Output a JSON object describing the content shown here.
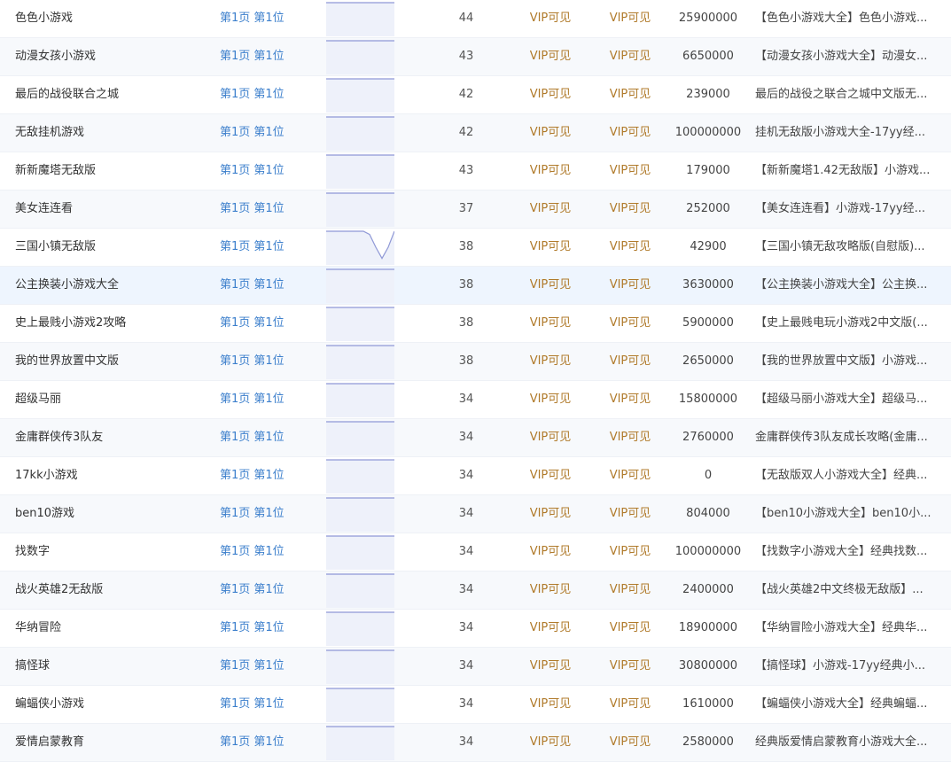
{
  "rows": [
    {
      "keyword": "色色小游戏",
      "rank": "第1页 第1位",
      "trend": [
        1,
        1,
        1,
        1,
        1,
        1,
        1
      ],
      "index": "44",
      "vip1": "VIP可见",
      "vip2": "VIP可见",
      "results": "25900000",
      "title": "【色色小游戏大全】色色小游戏..."
    },
    {
      "keyword": "动漫女孩小游戏",
      "rank": "第1页 第1位",
      "trend": [
        1,
        1,
        1,
        1,
        1,
        1,
        1
      ],
      "index": "43",
      "vip1": "VIP可见",
      "vip2": "VIP可见",
      "results": "6650000",
      "title": "【动漫女孩小游戏大全】动漫女..."
    },
    {
      "keyword": "最后的战役联合之城",
      "rank": "第1页 第1位",
      "trend": [
        1,
        1,
        1,
        1,
        1,
        1,
        1
      ],
      "index": "42",
      "vip1": "VIP可见",
      "vip2": "VIP可见",
      "results": "239000",
      "title": "最后的战役之联合之城中文版无..."
    },
    {
      "keyword": "无敌挂机游戏",
      "rank": "第1页 第1位",
      "trend": [
        1,
        1,
        1,
        1,
        1,
        1,
        1
      ],
      "index": "42",
      "vip1": "VIP可见",
      "vip2": "VIP可见",
      "results": "100000000",
      "title": "挂机无敌版小游戏大全-17yy经..."
    },
    {
      "keyword": "新新魔塔无敌版",
      "rank": "第1页 第1位",
      "trend": [
        1,
        1,
        1,
        1,
        1,
        1,
        1
      ],
      "index": "43",
      "vip1": "VIP可见",
      "vip2": "VIP可见",
      "results": "179000",
      "title": "【新新魔塔1.42无敌版】小游戏..."
    },
    {
      "keyword": "美女连连看",
      "rank": "第1页 第1位",
      "trend": [
        1,
        1,
        1,
        1,
        1,
        1,
        1
      ],
      "index": "37",
      "vip1": "VIP可见",
      "vip2": "VIP可见",
      "results": "252000",
      "title": "【美女连连看】小游戏-17yy经..."
    },
    {
      "keyword": "三国小镇无敌版",
      "rank": "第1页 第1位",
      "trend": [
        1,
        1,
        1,
        1,
        1,
        1,
        1,
        0.9,
        0.5,
        0.15,
        0.5,
        1
      ],
      "index": "38",
      "vip1": "VIP可见",
      "vip2": "VIP可见",
      "results": "42900",
      "title": "【三国小镇无敌攻略版(自慰版)..."
    },
    {
      "keyword": "公主换装小游戏大全",
      "rank": "第1页 第1位",
      "trend": [
        1,
        1,
        1,
        1,
        1,
        1,
        1
      ],
      "index": "38",
      "vip1": "VIP可见",
      "vip2": "VIP可见",
      "results": "3630000",
      "title": "【公主换装小游戏大全】公主换..."
    },
    {
      "keyword": "史上最贱小游戏2攻略",
      "rank": "第1页 第1位",
      "trend": [
        1,
        1,
        1,
        1,
        1,
        1,
        1
      ],
      "index": "38",
      "vip1": "VIP可见",
      "vip2": "VIP可见",
      "results": "5900000",
      "title": "【史上最贱电玩小游戏2中文版(..."
    },
    {
      "keyword": "我的世界放置中文版",
      "rank": "第1页 第1位",
      "trend": [
        1,
        1,
        1,
        1,
        1,
        1,
        1
      ],
      "index": "38",
      "vip1": "VIP可见",
      "vip2": "VIP可见",
      "results": "2650000",
      "title": "【我的世界放置中文版】小游戏..."
    },
    {
      "keyword": "超级马丽",
      "rank": "第1页 第1位",
      "trend": [
        1,
        1,
        1,
        1,
        1,
        1,
        1
      ],
      "index": "34",
      "vip1": "VIP可见",
      "vip2": "VIP可见",
      "results": "15800000",
      "title": "【超级马丽小游戏大全】超级马..."
    },
    {
      "keyword": "金庸群侠传3队友",
      "rank": "第1页 第1位",
      "trend": [
        1,
        1,
        1,
        1,
        1,
        1,
        1
      ],
      "index": "34",
      "vip1": "VIP可见",
      "vip2": "VIP可见",
      "results": "2760000",
      "title": "金庸群侠传3队友成长攻略(金庸..."
    },
    {
      "keyword": "17kk小游戏",
      "rank": "第1页 第1位",
      "trend": [
        1,
        1,
        1,
        1,
        1,
        1,
        1
      ],
      "index": "34",
      "vip1": "VIP可见",
      "vip2": "VIP可见",
      "results": "0",
      "title": "【无敌版双人小游戏大全】经典..."
    },
    {
      "keyword": "ben10游戏",
      "rank": "第1页 第1位",
      "trend": [
        1,
        1,
        1,
        1,
        1,
        1,
        1
      ],
      "index": "34",
      "vip1": "VIP可见",
      "vip2": "VIP可见",
      "results": "804000",
      "title": "【ben10小游戏大全】ben10小..."
    },
    {
      "keyword": "找数字",
      "rank": "第1页 第1位",
      "trend": [
        1,
        1,
        1,
        1,
        1,
        1,
        1
      ],
      "index": "34",
      "vip1": "VIP可见",
      "vip2": "VIP可见",
      "results": "100000000",
      "title": "【找数字小游戏大全】经典找数..."
    },
    {
      "keyword": "战火英雄2无敌版",
      "rank": "第1页 第1位",
      "trend": [
        1,
        1,
        1,
        1,
        1,
        1,
        1
      ],
      "index": "34",
      "vip1": "VIP可见",
      "vip2": "VIP可见",
      "results": "2400000",
      "title": "【战火英雄2中文终极无敌版】..."
    },
    {
      "keyword": "华纳冒险",
      "rank": "第1页 第1位",
      "trend": [
        1,
        1,
        1,
        1,
        1,
        1,
        1
      ],
      "index": "34",
      "vip1": "VIP可见",
      "vip2": "VIP可见",
      "results": "18900000",
      "title": "【华纳冒险小游戏大全】经典华..."
    },
    {
      "keyword": "搞怪球",
      "rank": "第1页 第1位",
      "trend": [
        1,
        1,
        1,
        1,
        1,
        1,
        1
      ],
      "index": "34",
      "vip1": "VIP可见",
      "vip2": "VIP可见",
      "results": "30800000",
      "title": "【搞怪球】小游戏-17yy经典小..."
    },
    {
      "keyword": "蝙蝠侠小游戏",
      "rank": "第1页 第1位",
      "trend": [
        1,
        1,
        1,
        1,
        1,
        1,
        1
      ],
      "index": "34",
      "vip1": "VIP可见",
      "vip2": "VIP可见",
      "results": "1610000",
      "title": "【蝙蝠侠小游戏大全】经典蝙蝠..."
    },
    {
      "keyword": "爱情启蒙教育",
      "rank": "第1页 第1位",
      "trend": [
        1,
        1,
        1,
        1,
        1,
        1,
        1
      ],
      "index": "34",
      "vip1": "VIP可见",
      "vip2": "VIP可见",
      "results": "2580000",
      "title": "经典版爱情启蒙教育小游戏大全..."
    }
  ],
  "highlight_row": 7,
  "colors": {
    "rank_link": "#3c7fcc",
    "vip_text": "#b07a2a",
    "trend_line": "#8f98d6",
    "trend_fill": "#eef1fa"
  }
}
